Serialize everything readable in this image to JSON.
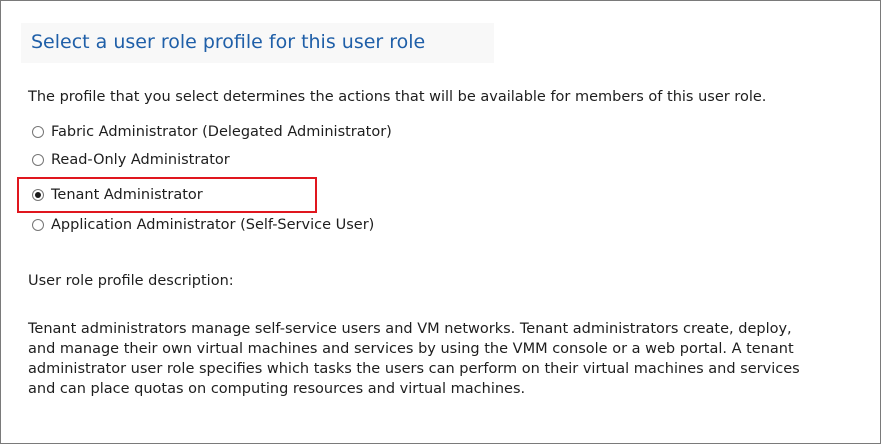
{
  "header": {
    "title": "Select a user role profile for this user role"
  },
  "intro_text": "The profile that you select determines the actions that will be available for members of this user role.",
  "profiles": [
    {
      "label": "Fabric Administrator (Delegated Administrator)",
      "selected": false
    },
    {
      "label": "Read-Only Administrator",
      "selected": false
    },
    {
      "label": "Tenant Administrator",
      "selected": true
    },
    {
      "label": "Application Administrator (Self-Service User)",
      "selected": false
    }
  ],
  "description": {
    "heading": "User role profile description:",
    "lines": [
      "Tenant administrators manage self-service users and VM networks. Tenant administrators create, deploy,",
      "and manage their own virtual machines and services by using the VMM console or a web portal. A tenant",
      "administrator user role specifies which tasks the users can perform on their virtual machines and services",
      "and can place quotas on computing resources and virtual machines."
    ]
  },
  "colors": {
    "title": "#1f5fa8",
    "highlight": "#e0161e",
    "text": "#1e1e1e"
  }
}
